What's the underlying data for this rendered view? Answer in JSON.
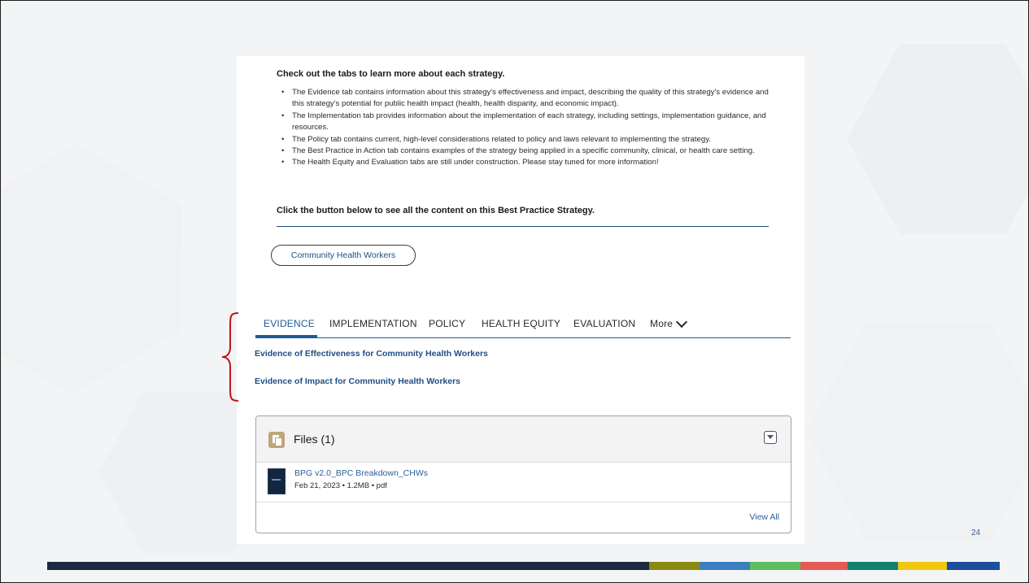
{
  "intro": {
    "heading": "Check out the tabs to learn more about each strategy.",
    "bullets": [
      "The Evidence tab contains information about this strategy's effectiveness and impact, describing the quality of this strategy's evidence and this strategy's potential for public health impact (health, health disparity, and economic impact).",
      "The Implementation tab provides information about the implementation of each strategy, including settings, implementation guidance, and resources.",
      "The Policy tab contains current, high-level considerations related to policy and laws relevant to implementing the strategy.",
      "The Best Practice in Action tab contains examples of the strategy being applied in a specific community, clinical, or health care setting.",
      "The Health Equity and Evaluation tabs are still under construction. Please stay tuned for more information!"
    ],
    "outro": "Click the button below to see all the content on this Best Practice Strategy."
  },
  "strategy_button": "Community Health Workers",
  "tabs": {
    "items": [
      "EVIDENCE",
      "IMPLEMENTATION",
      "POLICY",
      "HEALTH EQUITY",
      "EVALUATION"
    ],
    "more": "More",
    "active": "EVIDENCE"
  },
  "evidence_links": [
    "Evidence of Effectiveness for Community Health Workers",
    "Evidence of Impact for Community Health Workers"
  ],
  "files": {
    "title": "Files (1)",
    "file_name": "BPG v2.0_BPC Breakdown_CHWs",
    "file_meta": "Feb 21, 2023 • 1.2MB • pdf",
    "view_all": "View All"
  },
  "page_number": "24",
  "colors": {
    "link_blue": "#1f4e84",
    "tab_active": "#1f5c96",
    "annotation_red": "#c0141a",
    "footer": [
      "#1b2b40",
      "#8a8a10",
      "#3c7fc1",
      "#5bbf5b",
      "#e45a55",
      "#138070",
      "#f2c80f",
      "#1b4f9c"
    ]
  }
}
